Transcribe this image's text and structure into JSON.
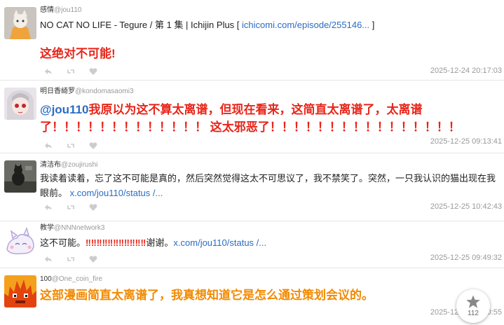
{
  "posts": [
    {
      "user": "感情",
      "handle": "@jou110",
      "title_text": "NO CAT NO LIFE - Tegure / 第 1 集 | Ichijin Plus [ ",
      "link": "ichicomi.com/episode/255146...",
      "title_end": " ]",
      "comment": "这绝对不可能!",
      "time": "2025-12-24 20:17:03"
    },
    {
      "user": "明日香綺罗",
      "handle": "@kondomasaomi3",
      "mention": "@jou110",
      "line1": "我原以为这不算太离谱，但现在看来，这简直太离谱了，太离谱",
      "line2": "了！！！！！！！！！！！！！ 这太邪恶了！！！！！！！！！！！！！！！！",
      "time": "2025-12-25 09:13:41"
    },
    {
      "user": "清洁布",
      "handle": "@zoujirushi",
      "text": "我读着读着，忘了这不可能是真的，然后突然觉得这太不可思议了，我不禁笑了。突然，一只我认识的猫出现在我眼前。",
      "link": "x.com/jou110/status /...",
      "time": "2025-12-25 10:42:43"
    },
    {
      "user": "教学",
      "handle": "@NNNnetwork3",
      "text": "这不可能。",
      "excl": "‼‼‼‼‼‼‼‼‼‼‼",
      "thanks": "谢谢。",
      "link": "x.com/jou110/status /...",
      "time": "2025-12-25 09:49:32"
    },
    {
      "user": "100",
      "handle": "@One_coin_fire",
      "text": "这部漫画简直太离谱了，我真想知道它是怎么通过策划会议的。",
      "time": "2025-12-25 10:40:55"
    }
  ],
  "fab": {
    "count": "112",
    "icon": "star-icon"
  },
  "icons": {
    "reply": "reply-icon",
    "retweet": "retweet-icon",
    "like": "heart-icon"
  },
  "colors": {
    "link": "#2b6cc4",
    "red": "#e8251a",
    "orange": "#f28a00",
    "meta": "#999999"
  }
}
